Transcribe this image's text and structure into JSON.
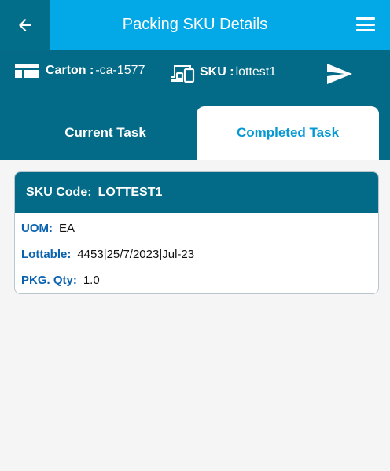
{
  "header": {
    "title": "Packing SKU Details",
    "back_icon": "arrow-left-icon",
    "menu_icon": "hamburger-menu-icon"
  },
  "info": {
    "carton_label": "Carton :",
    "carton_value": "-ca-1577",
    "sku_label": "SKU :",
    "sku_value": "lottest1",
    "send_icon": "send-icon"
  },
  "tabs": [
    {
      "label": "Current Task",
      "selected": false
    },
    {
      "label": "Completed Task",
      "selected": true
    }
  ],
  "card": {
    "sku_code_label": "SKU Code:",
    "sku_code_value": "LOTTEST1",
    "fields": [
      {
        "label": "UOM:",
        "value": "EA"
      },
      {
        "label": "Lottable:",
        "value": "4453|25/7/2023|Jul-23"
      },
      {
        "label": "PKG. Qty:",
        "value": "1.0"
      }
    ]
  },
  "colors": {
    "primary": "#03a9e6",
    "dark": "#036b87",
    "accent_text": "#0599d4",
    "field_label": "#0b63b0"
  }
}
